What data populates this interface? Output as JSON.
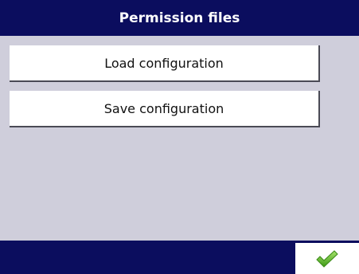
{
  "window": {
    "title": "Permission files"
  },
  "menu": {
    "items": [
      {
        "label": "Load configuration"
      },
      {
        "label": "Save configuration"
      }
    ]
  },
  "footer": {
    "confirm_icon": "checkmark-icon",
    "confirm_color": "#5fb82a"
  },
  "colors": {
    "bar": "#0b0d5e",
    "background": "#cfcedb",
    "button": "#ffffff"
  }
}
